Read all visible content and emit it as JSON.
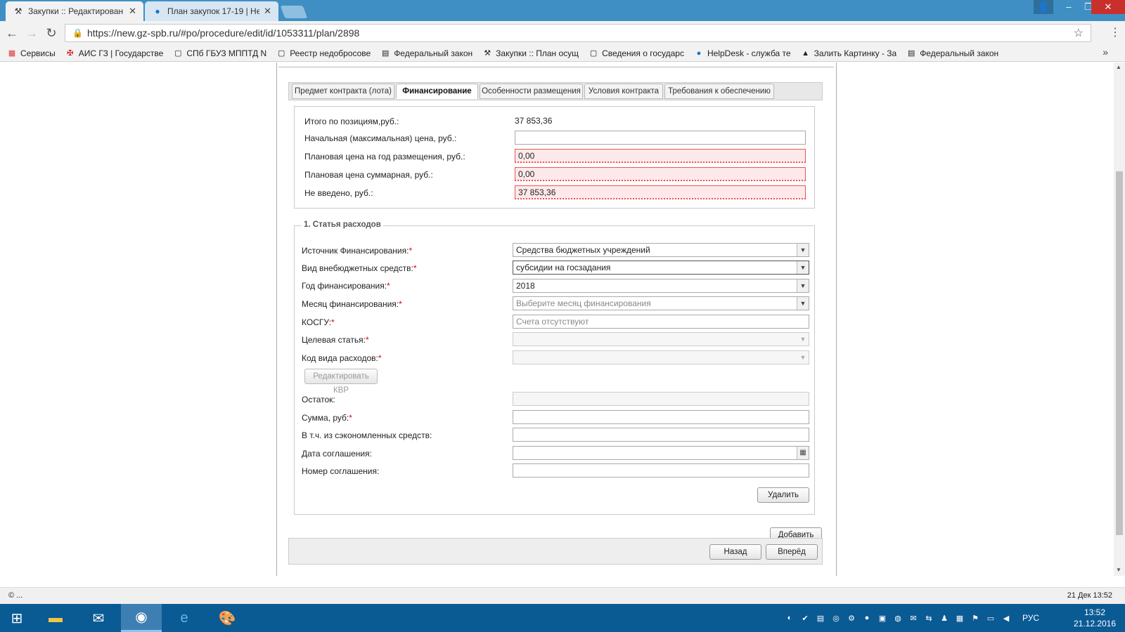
{
  "browser": {
    "tabs": [
      {
        "title": "Закупки :: Редактирован",
        "active": true
      },
      {
        "title": "План закупок 17-19 | Не",
        "active": false
      }
    ],
    "url": "https://new.gz-spb.ru/#po/procedure/edit/id/1053311/plan/2898",
    "bookmarks": [
      {
        "label": "Сервисы",
        "icon": "apps-grid-icon"
      },
      {
        "label": "АИС ГЗ | Государстве",
        "icon": "coat-of-arms-icon"
      },
      {
        "label": "СПб ГБУЗ МППТД N",
        "icon": "page-icon"
      },
      {
        "label": "Реестр недобросове",
        "icon": "page-icon"
      },
      {
        "label": "Федеральный закон",
        "icon": "document-icon"
      },
      {
        "label": "Закупки :: План осущ",
        "icon": "gavel-icon"
      },
      {
        "label": "Сведения о государс",
        "icon": "page-icon"
      },
      {
        "label": "HelpDesk - служба те",
        "icon": "globe-icon"
      },
      {
        "label": "Залить Картинку - За",
        "icon": "image-icon"
      },
      {
        "label": "Федеральный закон",
        "icon": "document-icon"
      }
    ]
  },
  "subtabs": [
    {
      "label": "Предмет контракта (лота)",
      "active": false
    },
    {
      "label": "Финансирование",
      "active": true
    },
    {
      "label": "Особенности размещения",
      "active": false
    },
    {
      "label": "Условия контракта",
      "active": false
    },
    {
      "label": "Требования к обеспечению",
      "active": false
    }
  ],
  "summary": {
    "total_label": "Итого по позициям,руб.:",
    "total_value": "37 853,36",
    "nmc_label": "Начальная (максимальная) цена, руб.:",
    "nmc_value": "",
    "plan_year_label": "Плановая цена на год размещения, руб.:",
    "plan_year_value": "0,00",
    "plan_sum_label": "Плановая цена суммарная, руб.:",
    "plan_sum_value": "0,00",
    "not_entered_label": "Не введено, руб.:",
    "not_entered_value": "37 853,36"
  },
  "expense": {
    "legend": "1. Статья расходов",
    "source_label": "Источник Финансирования:",
    "source_value": "Средства бюджетных учреждений",
    "offbudget_label": "Вид внебюджетных средств:",
    "offbudget_value": "субсидии на госзадания",
    "year_label": "Год финансирования:",
    "year_value": "2018",
    "month_label": "Месяц финансирования:",
    "month_placeholder": "Выберите месяц финансирования",
    "kosgu_label": "КОСГУ:",
    "kosgu_placeholder": "Счета отсутствуют",
    "target_label": "Целевая статья:",
    "kvr_label": "Код вида расходов:",
    "edit_kvr_button": "Редактировать КВР",
    "remainder_label": "Остаток:",
    "amount_label": "Сумма, руб:",
    "saved_label": "В т.ч. из сэкономленных средств:",
    "agreement_date_label": "Дата соглашения:",
    "agreement_number_label": "Номер соглашения:",
    "delete_button": "Удалить",
    "required_mark": "*"
  },
  "actions": {
    "add_button": "Добавить",
    "back_button": "Назад",
    "next_button": "Вперёд"
  },
  "status": {
    "left": "© ...",
    "right": "21 Дек 13:52"
  },
  "taskbar": {
    "lang": "РУС",
    "time": "13:52",
    "date": "21.12.2016"
  }
}
